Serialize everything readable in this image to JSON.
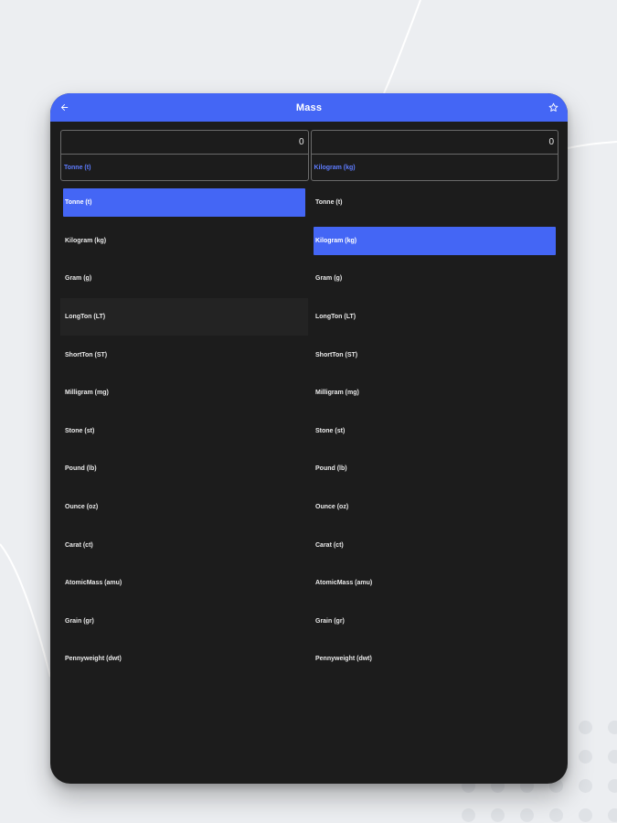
{
  "app_bar": {
    "title": "Mass",
    "back_icon": "arrow-left-icon",
    "favorite_icon": "star-outline-icon"
  },
  "converter": {
    "from": {
      "value": "0",
      "unit": "Tonne (t)"
    },
    "to": {
      "value": "0",
      "unit": "Kilogram (kg)"
    }
  },
  "units": [
    "Tonne (t)",
    "Kilogram (kg)",
    "Gram (g)",
    "LongTon (LT)",
    "ShortTon (ST)",
    "Milligram (mg)",
    "Stone (st)",
    "Pound (lb)",
    "Ounce (oz)",
    "Carat (ct)",
    "AtomicMass (amu)",
    "Grain (gr)",
    "Pennyweight (dwt)"
  ],
  "left_selected_index": 0,
  "left_hover_index": 3,
  "right_selected_index": 1,
  "colors": {
    "accent": "#4466f5",
    "surface": "#1c1c1c",
    "background": "#eceef1",
    "unit_label": "#5e7cff"
  }
}
